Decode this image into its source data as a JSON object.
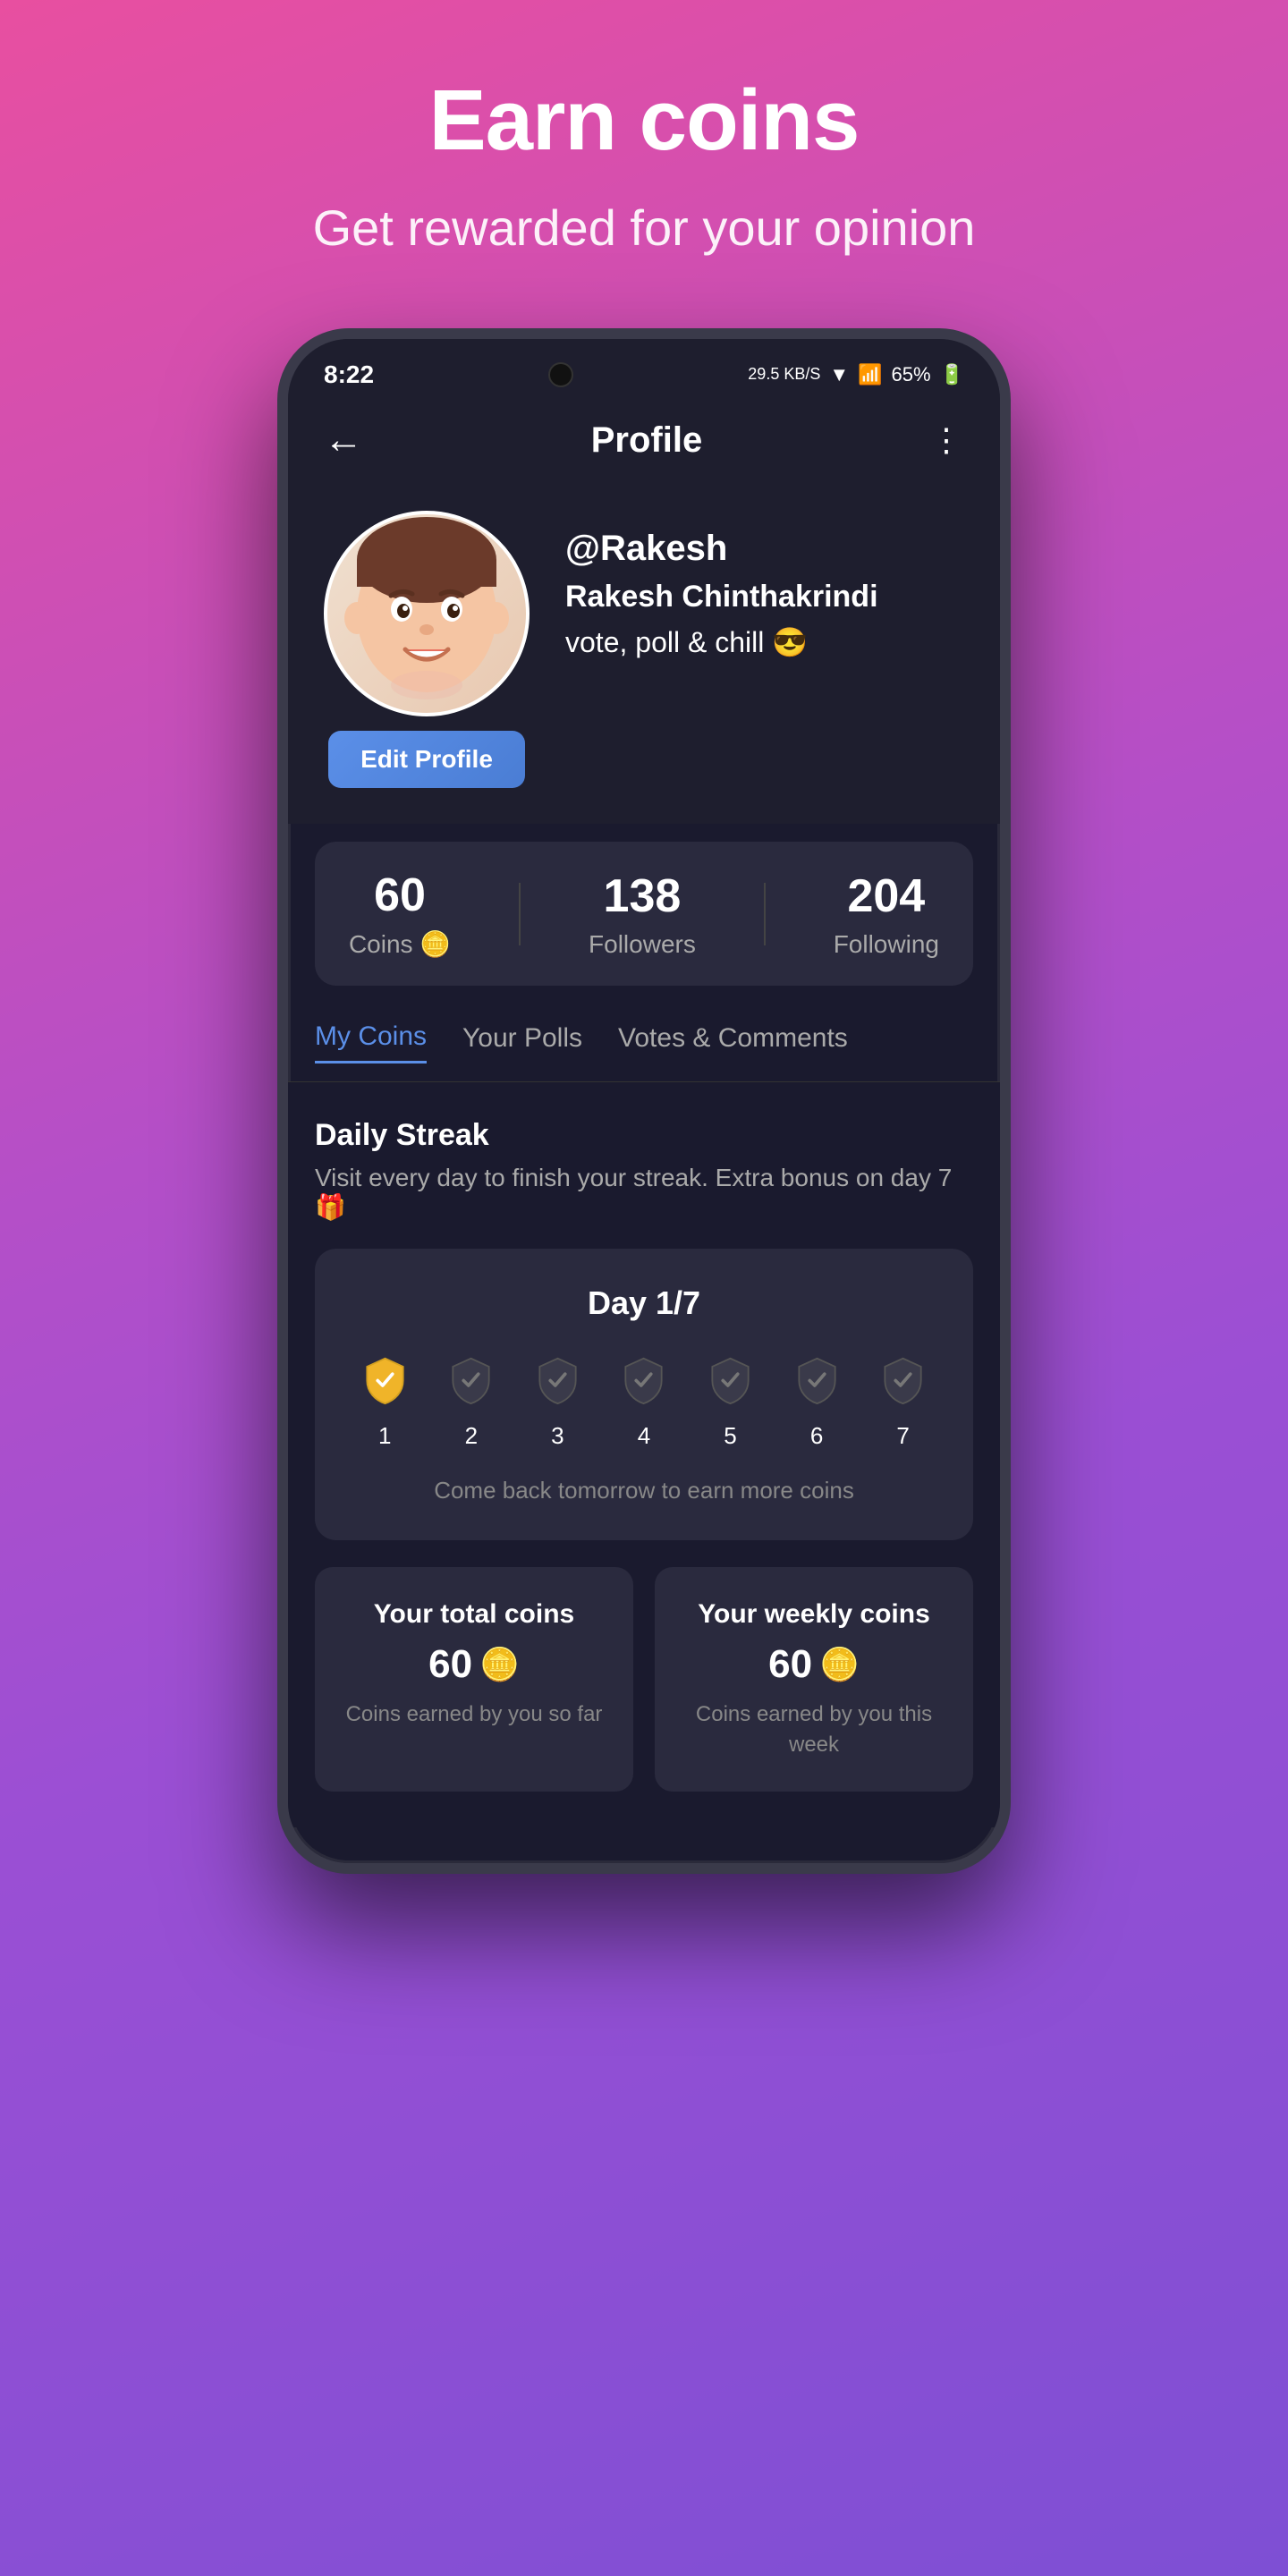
{
  "hero": {
    "title": "Earn coins",
    "subtitle": "Get rewarded for your opinion"
  },
  "phone": {
    "statusBar": {
      "time": "8:22",
      "netSpeed": "29.5 KB/S",
      "signal": "WiFi",
      "battery": "65%"
    },
    "navBar": {
      "title": "Profile",
      "backIcon": "←",
      "moreIcon": "⋮"
    },
    "profile": {
      "username": "@Rakesh",
      "fullName": "Rakesh Chinthakrindi",
      "bio": "vote, poll & chill 😎",
      "editLabel": "Edit Profile"
    },
    "stats": {
      "coins": {
        "value": "60",
        "label": "Coins 🪙"
      },
      "followers": {
        "value": "138",
        "label": "Followers"
      },
      "following": {
        "value": "204",
        "label": "Following"
      }
    },
    "tabs": [
      {
        "id": "my-coins",
        "label": "My Coins",
        "active": true
      },
      {
        "id": "your-polls",
        "label": "Your Polls",
        "active": false
      },
      {
        "id": "votes-comments",
        "label": "Votes & Comments",
        "active": false
      }
    ],
    "dailyStreak": {
      "title": "Daily Streak",
      "subtitle": "Visit every day to finish your streak. Extra bonus on day 7 🎁",
      "dayLabel": "Day  1/7",
      "days": [
        1,
        2,
        3,
        4,
        5,
        6,
        7
      ],
      "hint": "Come back tomorrow to earn more coins"
    },
    "coinsSection": {
      "totalCoins": {
        "title": "Your total coins",
        "value": "60",
        "sub": "Coins earned by you so far"
      },
      "weeklyCoins": {
        "title": "Your weekly coins",
        "value": "60",
        "sub": "Coins earned by you this week"
      }
    }
  }
}
